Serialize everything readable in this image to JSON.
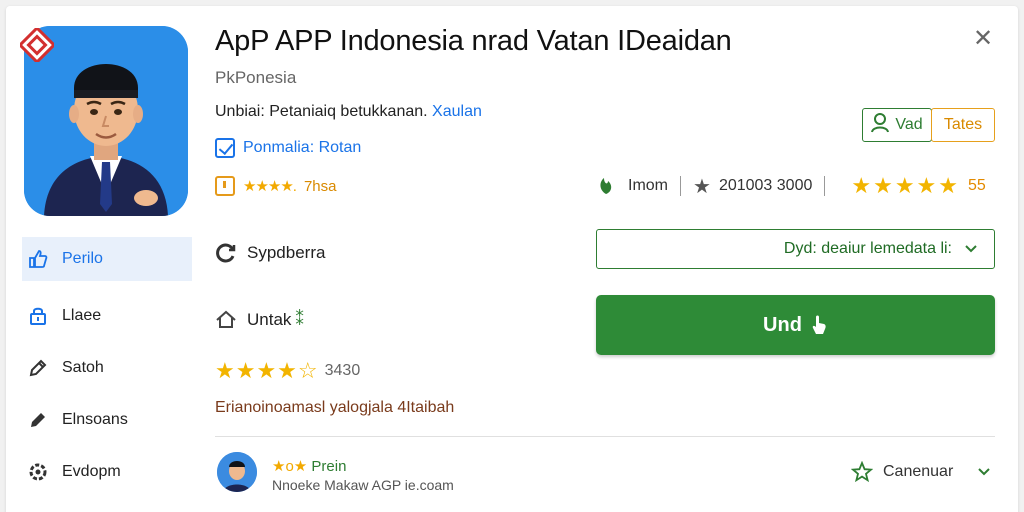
{
  "header": {
    "title": "ApP APP Indonesia nrad Vatan IDeaidan",
    "developer": "PkPonesia",
    "subline_text": "Unbiai: Petaniaiq betukkanan.",
    "subline_link": "Xaulan",
    "verified_label": "Ponmalia: Rotan",
    "small_rating_stars": "★★★★. ",
    "small_rating_value": "7hsa",
    "close_symbol": "✕"
  },
  "actions": {
    "vad_label": "Vad",
    "tates_label": "Tates"
  },
  "stats": {
    "installs_label": "Imom",
    "downloads_value": "201003 3000",
    "stars": "★★★★★",
    "rating_count": "55"
  },
  "sidebar": {
    "items": [
      {
        "label": "Perilo",
        "icon": "thumbs-up-icon",
        "active": true
      },
      {
        "label": "Llaee",
        "icon": "lock-icon",
        "active": false
      },
      {
        "label": "Satoh",
        "icon": "pencil-icon",
        "active": false
      },
      {
        "label": "Elnsoans",
        "icon": "edit-icon",
        "active": false
      },
      {
        "label": "Evdopm",
        "icon": "settings-icon",
        "active": false
      }
    ]
  },
  "main": {
    "sync_label": "Sypdberra",
    "untak_label": "Untak",
    "untak_suffix": "⁑",
    "dropdown_value": "Dyd: deaiur lemedata li:",
    "install_label": "Und",
    "rating_stars": "★★★★☆",
    "rating_value": "3430",
    "description": "Erianoinoamasl yalogjala 4Itaibah"
  },
  "review": {
    "stars": "★o★ ",
    "name": "Prein",
    "subtitle": "Nnoeke Makaw AGP ie.coam",
    "action_label": "Canenuar"
  },
  "colors": {
    "accent_blue": "#1a73e8",
    "accent_green": "#2e8b37",
    "star_gold": "#f2b400",
    "accent_orange": "#e6a01c"
  }
}
